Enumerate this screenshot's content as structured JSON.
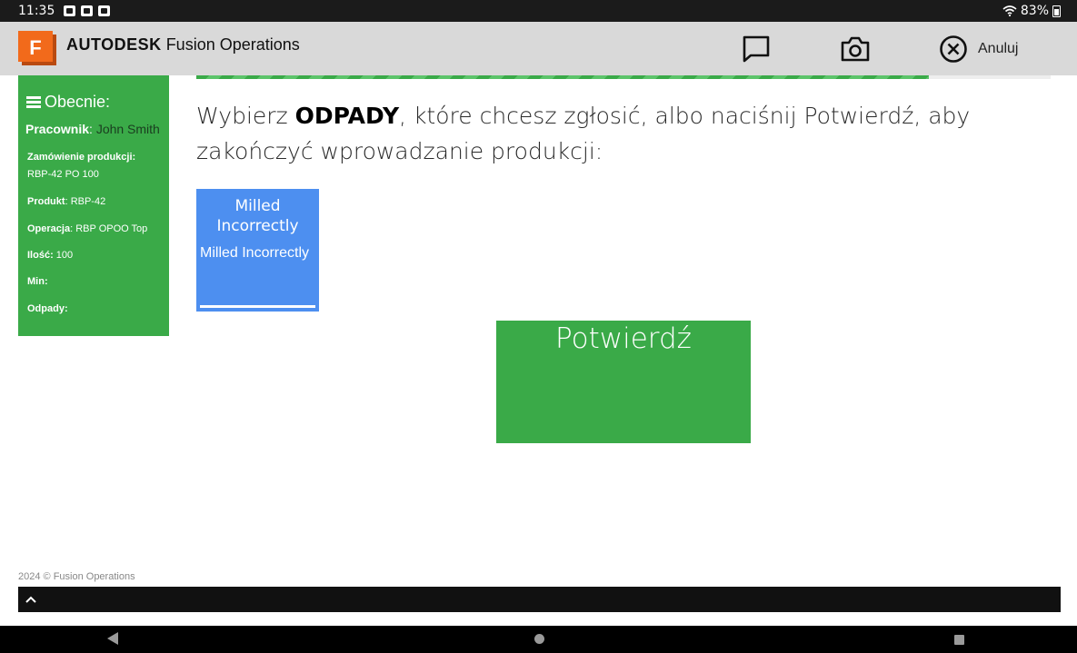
{
  "status_bar": {
    "time": "11:35",
    "battery": "83%",
    "icons": [
      "gallery-icon",
      "media-icon",
      "app-icon",
      "wifi-icon",
      "battery-icon"
    ]
  },
  "header": {
    "brand_bold": "AUTODESK",
    "brand_rest": " Fusion Operations",
    "logo_letter": "F",
    "cancel_label": "Anuluj",
    "icons": [
      "chat-icon",
      "camera-icon",
      "cancel-circle-icon"
    ]
  },
  "sidebar": {
    "title": "Obecnie:",
    "worker_label": "Pracownik",
    "worker_value": "John Smith",
    "order_label": "Zamówienie produkcji:",
    "order_value": "RBP-42 PO 100",
    "product_label": "Produkt",
    "product_value": "RBP-42",
    "operation_label": "Operacja",
    "operation_value": "RBP OPOO Top",
    "qty_label": "Ilość:",
    "qty_value": "100",
    "min_label": "Min:",
    "waste_label": "Odpady:"
  },
  "main": {
    "prompt_before": "Wybierz ",
    "prompt_bold": "ODPADY",
    "prompt_after": ", które chcesz zgłosić, albo naciśnij Potwierdź, aby zakończyć wprowadzanie produkcji:",
    "waste_items": [
      {
        "title": "Milled Incorrectly",
        "subtitle": "Milled Incorrectly"
      }
    ],
    "confirm_label": "Potwierdź"
  },
  "footer": {
    "copyright": "2024 © Fusion Operations"
  },
  "colors": {
    "green": "#3aaa48",
    "tile_blue": "#4d8ff0",
    "header_gray": "#d9d9d9",
    "logo_orange": "#f26a1b"
  }
}
